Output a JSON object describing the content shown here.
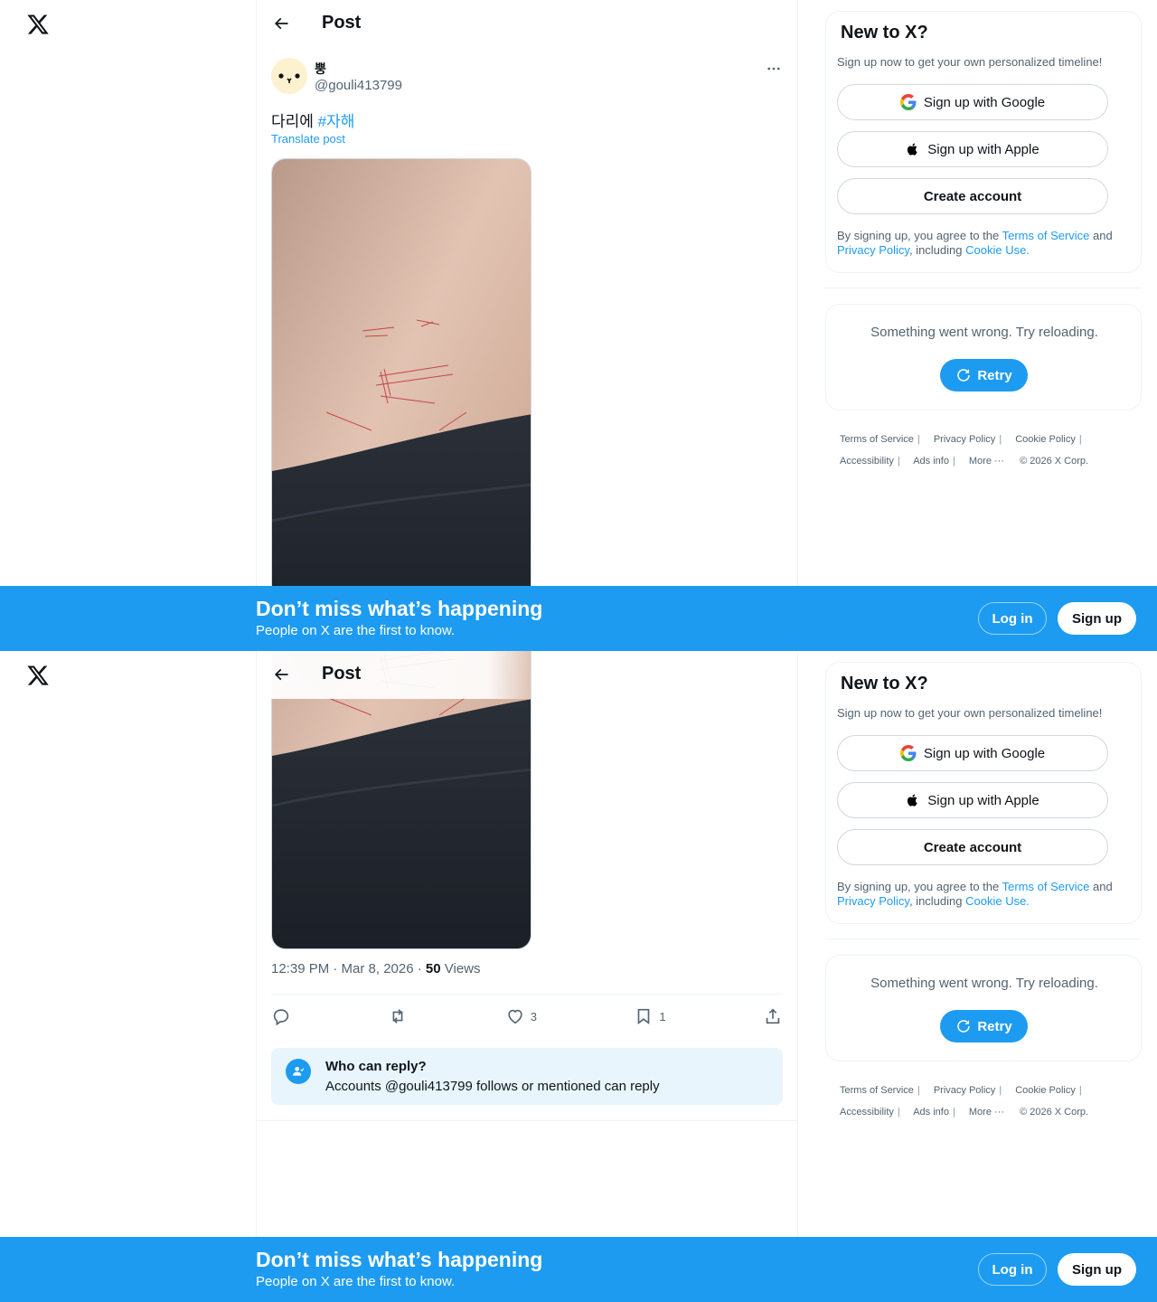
{
  "header": {
    "title": "Post"
  },
  "post": {
    "display_name": "뿡",
    "handle": "@gouli413799",
    "text_plain": "다리에 ",
    "hashtag": "#자해",
    "translate_label": "Translate post",
    "time": "12:39 PM · Mar 8, 2026 · ",
    "views_count": "50",
    "views_label": " Views",
    "likes": "3",
    "bookmarks": "1"
  },
  "who_can_reply": {
    "title": "Who can reply?",
    "subtitle": "Accounts @gouli413799 follows or mentioned can reply"
  },
  "signup_card": {
    "title": "New to X?",
    "subtitle": "Sign up now to get your own personalized timeline!",
    "google_label": "Sign up with Google",
    "apple_label": "Sign up with Apple",
    "create_label": "Create account",
    "legal_prefix": "By signing up, you agree to the ",
    "terms_link": "Terms of Service",
    "legal_and": " and ",
    "privacy_link": "Privacy Policy",
    "legal_including": ", including ",
    "cookie_link": "Cookie Use."
  },
  "error_card": {
    "message": "Something went wrong. Try reloading.",
    "retry_label": "Retry"
  },
  "footer": {
    "terms": "Terms of Service",
    "privacy": "Privacy Policy",
    "cookie": "Cookie Policy",
    "accessibility": "Accessibility",
    "ads": "Ads info",
    "more": "More ···",
    "copyright": "© 2026 X Corp."
  },
  "banner": {
    "title": "Don’t miss what’s happening",
    "subtitle": "People on X are the first to know.",
    "login_label": "Log in",
    "signup_label": "Sign up"
  },
  "colors": {
    "accent": "#1d9bf0",
    "text_primary": "#0f1419",
    "text_secondary": "#536471"
  }
}
